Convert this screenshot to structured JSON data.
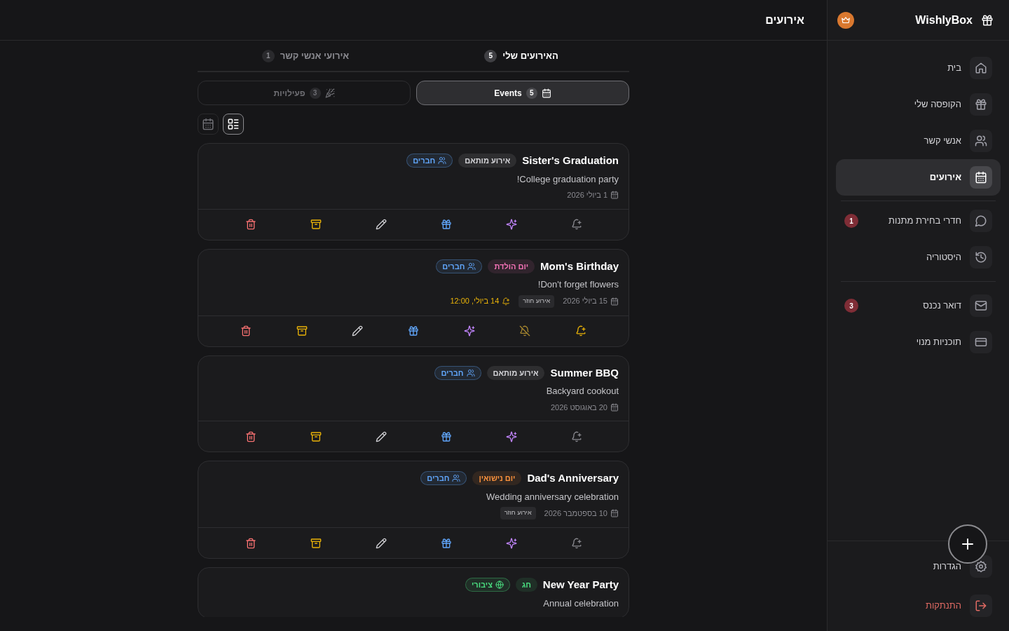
{
  "sidebar": {
    "brand": "WishlyBox",
    "items": [
      {
        "label": "בית",
        "selected": false
      },
      {
        "label": "הקופסה שלי",
        "selected": false
      },
      {
        "label": "אנשי קשר",
        "selected": false
      },
      {
        "label": "אירועים",
        "selected": true,
        "divider_after": true
      },
      {
        "label": "חדרי בחירת מתנות",
        "selected": false,
        "badge": "1"
      },
      {
        "label": "היסטוריה",
        "selected": false,
        "divider_after": true
      },
      {
        "label": "דואר נכנס",
        "selected": false,
        "badge": "3"
      },
      {
        "label": "תוכניות מנוי",
        "selected": false
      }
    ],
    "footer": [
      {
        "label": "הגדרות",
        "kind": "normal"
      },
      {
        "label": "התנתקות",
        "kind": "danger"
      }
    ]
  },
  "header": {
    "title": "אירועים"
  },
  "tabs": [
    {
      "label": "האירועים שלי",
      "count": "5",
      "selected": true
    },
    {
      "label": "אירועי אנשי קשר",
      "count": "1",
      "selected": false
    }
  ],
  "subtabs": [
    {
      "label": "Events",
      "count": "5",
      "selected": true
    },
    {
      "label": "פעילויות",
      "count": "3",
      "selected": false
    }
  ],
  "views": [
    {
      "kind": "list",
      "selected": true
    },
    {
      "kind": "calendar",
      "selected": false
    }
  ],
  "events": [
    {
      "title": "Sister's Graduation",
      "tags": [
        {
          "label": "אירוע מותאם",
          "color": "#d4d4d8",
          "kind": "category"
        },
        {
          "label": "חברים",
          "color": "#60a5fa",
          "kind": "audience"
        }
      ],
      "description": "College graduation party!",
      "date": "1 ביולי 2026",
      "reminder_set": false
    },
    {
      "title": "Mom's Birthday",
      "tags": [
        {
          "label": "יום הולדת",
          "color": "#f472b6",
          "kind": "category"
        },
        {
          "label": "חברים",
          "color": "#60a5fa",
          "kind": "audience"
        }
      ],
      "description": "Don't forget flowers!",
      "date": "15 ביולי 2026",
      "recurring": "אירוע חוזר",
      "reminder": "14 ביולי, 12:00",
      "reminder_set": true
    },
    {
      "title": "Summer BBQ",
      "tags": [
        {
          "label": "אירוע מותאם",
          "color": "#d4d4d8",
          "kind": "category"
        },
        {
          "label": "חברים",
          "color": "#60a5fa",
          "kind": "audience"
        }
      ],
      "description": "Backyard cookout",
      "date": "20 באוגוסט 2026",
      "reminder_set": false
    },
    {
      "title": "Dad's Anniversary",
      "tags": [
        {
          "label": "יום נישואין",
          "color": "#fb923c",
          "kind": "category"
        },
        {
          "label": "חברים",
          "color": "#60a5fa",
          "kind": "audience"
        }
      ],
      "description": "Wedding anniversary celebration",
      "date": "10 בספטמבר 2026",
      "recurring": "אירוע חוזר",
      "reminder_set": false
    },
    {
      "title": "New Year Party",
      "tags": [
        {
          "label": "חג",
          "color": "#4ade80",
          "kind": "category"
        },
        {
          "label": "ציבורי",
          "color": "#4ade80",
          "kind": "public"
        }
      ],
      "description": "Annual celebration"
    }
  ]
}
